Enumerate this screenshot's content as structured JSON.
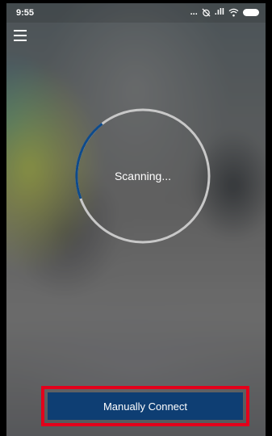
{
  "status_bar": {
    "time": "9:55",
    "icons": [
      "more-dots-icon",
      "alarm-off-icon",
      "signal-icon",
      "wifi-icon",
      "battery-icon"
    ],
    "more_text": "...",
    "signal_text": ".ıll"
  },
  "header": {
    "menu_icon": "hamburger-menu-icon"
  },
  "scanner": {
    "label": "Scanning...",
    "progress_fraction": 0.2,
    "ring_color": "#c8c8c8",
    "progress_color": "#0e4a8a"
  },
  "footer": {
    "connect_label": "Manually Connect",
    "button_color": "#0e3e73",
    "highlight_color": "#e3001b"
  }
}
